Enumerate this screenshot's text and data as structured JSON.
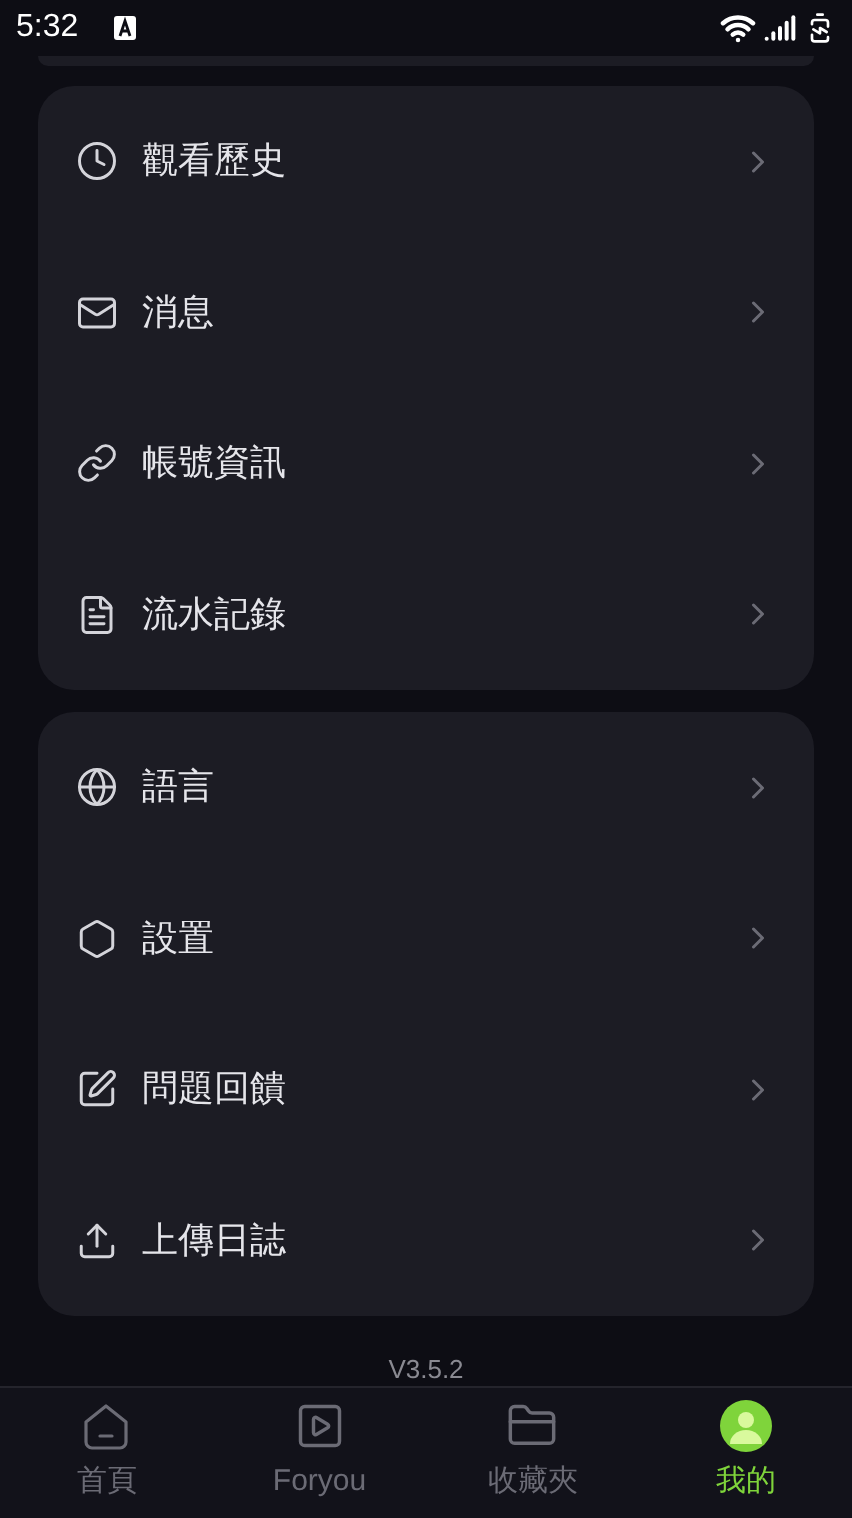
{
  "status_bar": {
    "time": "5:32"
  },
  "menu_groups": [
    {
      "items": [
        {
          "kind": "clock",
          "label": "觀看歷史"
        },
        {
          "kind": "mail",
          "label": "消息"
        },
        {
          "kind": "link",
          "label": "帳號資訊"
        },
        {
          "kind": "document",
          "label": "流水記錄"
        }
      ]
    },
    {
      "items": [
        {
          "kind": "globe",
          "label": "語言"
        },
        {
          "kind": "hexagon",
          "label": "設置"
        },
        {
          "kind": "edit",
          "label": "問題回饋"
        },
        {
          "kind": "upload",
          "label": "上傳日誌"
        }
      ]
    }
  ],
  "version": "V3.5.2",
  "bottom_nav": [
    {
      "kind": "home",
      "label": "首頁",
      "selected": false
    },
    {
      "kind": "play",
      "label": "Foryou",
      "selected": false
    },
    {
      "kind": "folder",
      "label": "收藏夾",
      "selected": false
    },
    {
      "kind": "avatar",
      "label": "我的",
      "selected": true
    }
  ]
}
